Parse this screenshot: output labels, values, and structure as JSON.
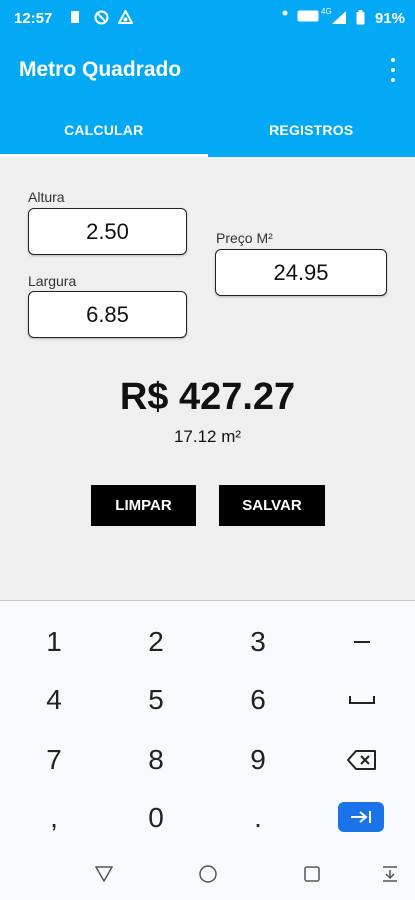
{
  "status_bar": {
    "time": "12:57",
    "network": "4G",
    "battery": "91%"
  },
  "app": {
    "title": "Metro Quadrado"
  },
  "tabs": [
    {
      "label": "CALCULAR",
      "active": true
    },
    {
      "label": "REGISTROS",
      "active": false
    }
  ],
  "form": {
    "altura": {
      "label": "Altura",
      "value": "2.50"
    },
    "largura": {
      "label": "Largura",
      "value": "6.85"
    },
    "preco": {
      "label": "Preço M²",
      "value": "24.95"
    }
  },
  "result": {
    "total": "R$ 427.27",
    "area": "17.12 m²"
  },
  "buttons": {
    "clear": "LIMPAR",
    "save": "SALVAR"
  },
  "keyboard": {
    "rows": [
      [
        "1",
        "2",
        "3",
        "−"
      ],
      [
        "4",
        "5",
        "6",
        "␣"
      ],
      [
        "7",
        "8",
        "9",
        "⌫"
      ],
      [
        ",",
        "0",
        ".",
        "⇥"
      ]
    ]
  },
  "colors": {
    "primary": "#03a9f4",
    "button": "#000000",
    "enter_key": "#1a73e8"
  },
  "icons": {
    "status_left": [
      "sim-icon",
      "do-not-disturb-icon",
      "sync-icon"
    ],
    "status_right": [
      "dot-icon",
      "volte-icon",
      "signal-icon",
      "battery-icon"
    ]
  }
}
